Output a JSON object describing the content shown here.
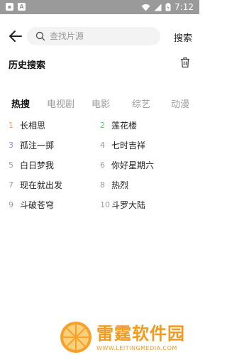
{
  "status_bar": {
    "time": "7:12"
  },
  "search": {
    "placeholder": "查找片源",
    "button_label": "搜索"
  },
  "history": {
    "title": "历史搜索"
  },
  "tabs": [
    {
      "label": "热搜",
      "active": true
    },
    {
      "label": "电视剧",
      "active": false
    },
    {
      "label": "电影",
      "active": false
    },
    {
      "label": "综艺",
      "active": false
    },
    {
      "label": "动漫",
      "active": false
    }
  ],
  "hot_list": [
    {
      "rank": "1",
      "title": "长相思",
      "rank_color": "#f5a25d"
    },
    {
      "rank": "2",
      "title": "莲花楼",
      "rank_color": "#4cd964"
    },
    {
      "rank": "3",
      "title": "孤注一掷",
      "rank_color": "#8c8cf0"
    },
    {
      "rank": "4",
      "title": "七时吉祥",
      "rank_color": "#9a9a9a"
    },
    {
      "rank": "5",
      "title": "白日梦我",
      "rank_color": "#9a9a9a"
    },
    {
      "rank": "6",
      "title": "你好星期六",
      "rank_color": "#9a9a9a"
    },
    {
      "rank": "7",
      "title": "现在就出发",
      "rank_color": "#9a9a9a"
    },
    {
      "rank": "8",
      "title": "热烈",
      "rank_color": "#9a9a9a"
    },
    {
      "rank": "9",
      "title": "斗破苍穹",
      "rank_color": "#9a9a9a"
    },
    {
      "rank": "10",
      "title": "斗罗大陆",
      "rank_color": "#9a9a9a"
    }
  ],
  "watermark": {
    "name": "雷霆软件园",
    "url": "WWW.LEITINGMEDIA.COM"
  },
  "colors": {
    "accent": "#f39a1e",
    "muted": "#9a9a9a"
  }
}
